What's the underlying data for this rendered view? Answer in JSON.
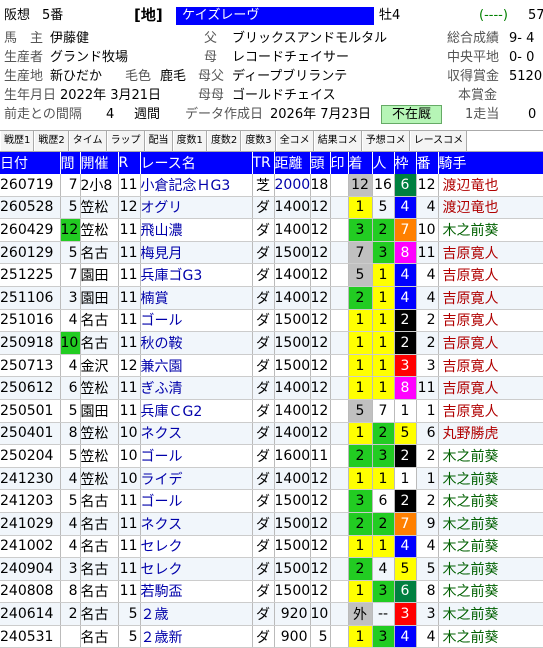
{
  "header": {
    "race_label": "阪想",
    "slot": "5番",
    "track_type": "[地]",
    "horse_name": "ケイズレーヴ",
    "sex_age": "牡4",
    "record_short": "(----)",
    "record_cut": "57",
    "owner_label": "馬　主",
    "owner": "伊藤健",
    "breeder_label": "生産者",
    "breeder": "グランド牧場",
    "birthplace_label": "生産地",
    "birthplace": "新ひだか",
    "coat_label": "毛色",
    "coat": "鹿毛",
    "birthdate_label": "生年月日",
    "birthdate": "2022年 3月21日",
    "interval_label": "前走との間隔",
    "interval_value": "4",
    "interval_unit": "週間",
    "sire_label": "父",
    "sire": "ブリックスアンドモルタル",
    "dam_label": "母",
    "dam": "レコードチェイサー",
    "damsire_label": "母父",
    "damsire": "ディープブリランテ",
    "granddam_label": "母母",
    "granddam": "ゴールドチェイス",
    "created_label": "データ作成日",
    "created": "2026年 7月23日",
    "status": "不在厩",
    "total_label": "総合成績",
    "total": "9- 4",
    "central_label": "中央平地",
    "central": "0- 0",
    "earnings_label": "収得賞金",
    "earnings": "5120",
    "prize_label": "本賞金",
    "prize": "",
    "first_run_label": "1走当",
    "first_run": "0"
  },
  "tabs": [
    "戦歴1",
    "戦歴2",
    "タイム",
    "ラップ",
    "配当",
    "度数1",
    "度数2",
    "度数3",
    "全コメ",
    "結果コメ",
    "予想コメ",
    "レースコメ"
  ],
  "columns": [
    "日付",
    "間",
    "開催",
    "R",
    "レース名",
    "TR",
    "距離",
    "頭",
    "印",
    "着",
    "人",
    "枠",
    "番",
    "騎手"
  ],
  "rows": [
    {
      "date": "260719",
      "gap": "7",
      "venue": "2小8",
      "r": "11",
      "race": "小倉記念ＨG3",
      "tr": "芝",
      "dist": "2000",
      "heads": "18",
      "mark": "",
      "pos": "12",
      "pop": "16",
      "waku": "6",
      "ban": "12",
      "jockey": "渡辺竜也"
    },
    {
      "date": "260528",
      "gap": "5",
      "venue": "笠松",
      "r": "12",
      "race": "オグリ",
      "tr": "ダ",
      "dist": "1400",
      "heads": "12",
      "mark": "",
      "pos": "1",
      "pop": "5",
      "waku": "4",
      "ban": "4",
      "jockey": "渡辺竜也"
    },
    {
      "date": "260429",
      "gap": "12",
      "venue": "笠松",
      "r": "11",
      "race": "飛山濃",
      "tr": "ダ",
      "dist": "1400",
      "heads": "12",
      "mark": "",
      "pos": "3",
      "pop": "2",
      "waku": "7",
      "ban": "10",
      "jockey": "木之前葵"
    },
    {
      "date": "260129",
      "gap": "5",
      "venue": "名古",
      "r": "11",
      "race": "梅見月",
      "tr": "ダ",
      "dist": "1500",
      "heads": "12",
      "mark": "",
      "pos": "7",
      "pop": "3",
      "waku": "8",
      "ban": "11",
      "jockey": "吉原寛人"
    },
    {
      "date": "251225",
      "gap": "7",
      "venue": "園田",
      "r": "11",
      "race": "兵庫ゴG3",
      "tr": "ダ",
      "dist": "1400",
      "heads": "12",
      "mark": "",
      "pos": "5",
      "pop": "1",
      "waku": "4",
      "ban": "4",
      "jockey": "吉原寛人"
    },
    {
      "date": "251106",
      "gap": "3",
      "venue": "園田",
      "r": "11",
      "race": "楠賞",
      "tr": "ダ",
      "dist": "1400",
      "heads": "12",
      "mark": "",
      "pos": "2",
      "pop": "1",
      "waku": "4",
      "ban": "4",
      "jockey": "吉原寛人"
    },
    {
      "date": "251016",
      "gap": "4",
      "venue": "名古",
      "r": "11",
      "race": "ゴール",
      "tr": "ダ",
      "dist": "1500",
      "heads": "12",
      "mark": "",
      "pos": "1",
      "pop": "1",
      "waku": "2",
      "ban": "2",
      "jockey": "吉原寛人"
    },
    {
      "date": "250918",
      "gap": "10",
      "venue": "名古",
      "r": "11",
      "race": "秋の鞍",
      "tr": "ダ",
      "dist": "1500",
      "heads": "12",
      "mark": "",
      "pos": "1",
      "pop": "1",
      "waku": "2",
      "ban": "2",
      "jockey": "吉原寛人"
    },
    {
      "date": "250713",
      "gap": "4",
      "venue": "金沢",
      "r": "12",
      "race": "兼六園",
      "tr": "ダ",
      "dist": "1500",
      "heads": "12",
      "mark": "",
      "pos": "1",
      "pop": "1",
      "waku": "3",
      "ban": "3",
      "jockey": "吉原寛人"
    },
    {
      "date": "250612",
      "gap": "6",
      "venue": "笠松",
      "r": "11",
      "race": "ぎふ清",
      "tr": "ダ",
      "dist": "1400",
      "heads": "12",
      "mark": "",
      "pos": "1",
      "pop": "1",
      "waku": "8",
      "ban": "11",
      "jockey": "吉原寛人"
    },
    {
      "date": "250501",
      "gap": "5",
      "venue": "園田",
      "r": "11",
      "race": "兵庫ＣG2",
      "tr": "ダ",
      "dist": "1400",
      "heads": "12",
      "mark": "",
      "pos": "5",
      "pop": "7",
      "waku": "1",
      "ban": "1",
      "jockey": "吉原寛人"
    },
    {
      "date": "250401",
      "gap": "8",
      "venue": "笠松",
      "r": "10",
      "race": "ネクス",
      "tr": "ダ",
      "dist": "1400",
      "heads": "12",
      "mark": "",
      "pos": "1",
      "pop": "2",
      "waku": "5",
      "ban": "6",
      "jockey": "丸野勝虎"
    },
    {
      "date": "250204",
      "gap": "5",
      "venue": "笠松",
      "r": "10",
      "race": "ゴール",
      "tr": "ダ",
      "dist": "1600",
      "heads": "11",
      "mark": "",
      "pos": "2",
      "pop": "3",
      "waku": "2",
      "ban": "2",
      "jockey": "木之前葵"
    },
    {
      "date": "241230",
      "gap": "4",
      "venue": "笠松",
      "r": "10",
      "race": "ライデ",
      "tr": "ダ",
      "dist": "1400",
      "heads": "12",
      "mark": "",
      "pos": "1",
      "pop": "1",
      "waku": "1",
      "ban": "1",
      "jockey": "木之前葵"
    },
    {
      "date": "241203",
      "gap": "5",
      "venue": "名古",
      "r": "11",
      "race": "ゴール",
      "tr": "ダ",
      "dist": "1500",
      "heads": "12",
      "mark": "",
      "pos": "3",
      "pop": "6",
      "waku": "2",
      "ban": "2",
      "jockey": "木之前葵"
    },
    {
      "date": "241029",
      "gap": "4",
      "venue": "名古",
      "r": "11",
      "race": "ネクス",
      "tr": "ダ",
      "dist": "1500",
      "heads": "12",
      "mark": "",
      "pos": "2",
      "pop": "2",
      "waku": "7",
      "ban": "9",
      "jockey": "木之前葵"
    },
    {
      "date": "241002",
      "gap": "4",
      "venue": "名古",
      "r": "11",
      "race": "セレク",
      "tr": "ダ",
      "dist": "1500",
      "heads": "12",
      "mark": "",
      "pos": "1",
      "pop": "1",
      "waku": "4",
      "ban": "4",
      "jockey": "木之前葵"
    },
    {
      "date": "240904",
      "gap": "3",
      "venue": "名古",
      "r": "11",
      "race": "セレク",
      "tr": "ダ",
      "dist": "1500",
      "heads": "12",
      "mark": "",
      "pos": "2",
      "pop": "4",
      "waku": "5",
      "ban": "5",
      "jockey": "木之前葵"
    },
    {
      "date": "240808",
      "gap": "8",
      "venue": "名古",
      "r": "11",
      "race": "若駒盃",
      "tr": "ダ",
      "dist": "1500",
      "heads": "12",
      "mark": "",
      "pos": "1",
      "pop": "3",
      "waku": "6",
      "ban": "8",
      "jockey": "木之前葵"
    },
    {
      "date": "240614",
      "gap": "2",
      "venue": "名古",
      "r": "5",
      "race": "２歳",
      "tr": "ダ",
      "dist": "920",
      "heads": "10",
      "mark": "",
      "pos": "外",
      "pop": "--",
      "waku": "3",
      "ban": "3",
      "jockey": "木之前葵"
    },
    {
      "date": "240531",
      "gap": "",
      "venue": "名古",
      "r": "5",
      "race": "２歳新",
      "tr": "ダ",
      "dist": "900",
      "heads": "5",
      "mark": "",
      "pos": "1",
      "pop": "3",
      "waku": "4",
      "ban": "4",
      "jockey": "木之前葵"
    }
  ],
  "colors": {
    "waku_bg": {
      "1": "#ffffff",
      "2": "#000000",
      "3": "#ff0000",
      "4": "#0000ff",
      "5": "#ffff00",
      "6": "#008040",
      "7": "#ff8000",
      "8": "#ff00ff"
    },
    "waku_fg": {
      "1": "#000000",
      "2": "#ffffff",
      "3": "#ffffff",
      "4": "#ffffff",
      "5": "#000000",
      "6": "#ffffff",
      "7": "#ffffff",
      "8": "#ffffff"
    },
    "pos_bg": {
      "1": "#ffff00",
      "2": "#22cc22",
      "3": "#22cc22",
      "other": "#c0c0c0"
    },
    "pop_bg": {
      "1": "#ffff00",
      "2": "#22cc22",
      "3": "#22cc22",
      "other": "transparent"
    }
  }
}
